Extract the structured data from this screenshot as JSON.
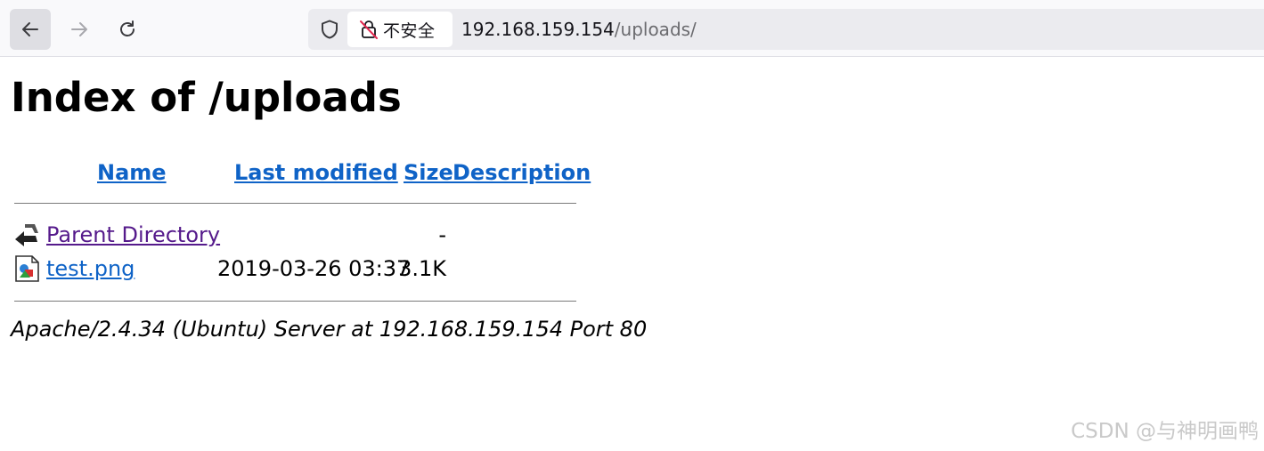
{
  "browser": {
    "security_label": "不安全",
    "url_host": "192.168.159.154",
    "url_path": "/uploads/"
  },
  "page": {
    "title": "Index of /uploads",
    "columns": {
      "name": "Name",
      "last_modified": "Last modified",
      "size": "Size",
      "description": "Description"
    },
    "rows": [
      {
        "name": "Parent Directory",
        "last_modified": "",
        "size": "-",
        "icon": "back-arrow-icon"
      },
      {
        "name": "test.png",
        "last_modified": "2019-03-26 03:37",
        "size": "3.1K",
        "icon": "image-file-icon"
      }
    ],
    "footer": "Apache/2.4.34 (Ubuntu) Server at 192.168.159.154 Port 80"
  },
  "watermark": "CSDN @与神明画鸭",
  "colors": {
    "link": "#0f63c7",
    "visited_link": "#551a8b",
    "toolbar_bg": "#f9f9fb",
    "urlbar_bg": "#ebebef"
  }
}
